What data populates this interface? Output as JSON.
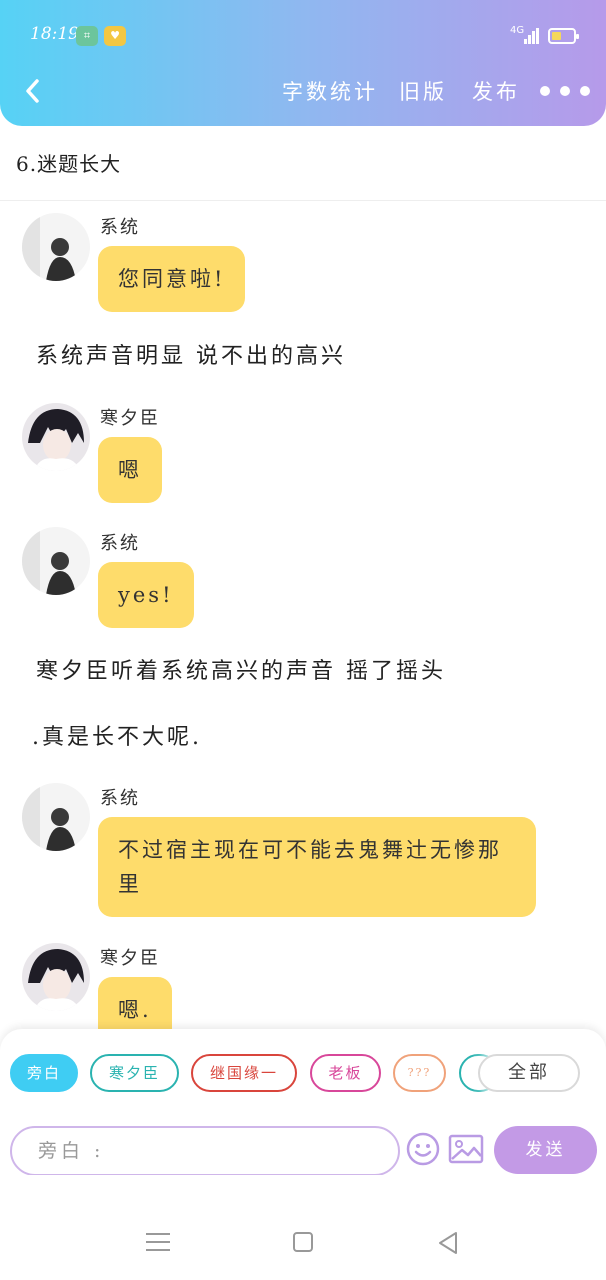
{
  "status_bar": {
    "time": "18:19",
    "network": "4G",
    "battery_level": 0.45
  },
  "header": {
    "actions": [
      "字数统计",
      "旧版",
      "发布"
    ],
    "gradient": [
      "#56d2f5",
      "#b69aea"
    ]
  },
  "chapter": {
    "title": "6.迷题长大"
  },
  "messages": [
    {
      "kind": "bubble",
      "speaker": "系统",
      "text": "您同意啦!",
      "avatar": "system"
    },
    {
      "kind": "narration",
      "text": "系统声音明显 说不出的高兴"
    },
    {
      "kind": "bubble",
      "speaker": "寒夕臣",
      "text": "嗯",
      "avatar": "hanxichen"
    },
    {
      "kind": "bubble",
      "speaker": "系统",
      "text": "yes!",
      "avatar": "system"
    },
    {
      "kind": "narration",
      "text": "寒夕臣听着系统高兴的声音 摇了摇头"
    },
    {
      "kind": "narration",
      "text": ".真是长不大呢."
    },
    {
      "kind": "bubble",
      "speaker": "系统",
      "text": "不过宿主现在可不能去鬼舞辻无惨那里",
      "avatar": "system"
    },
    {
      "kind": "bubble",
      "speaker": "寒夕臣",
      "text": "嗯.",
      "avatar": "hanxichen"
    }
  ],
  "role_chips": [
    {
      "label": "旁白",
      "color": "#3fcdf3",
      "active": true
    },
    {
      "label": "寒夕臣",
      "color": "#2ab3b0",
      "active": false
    },
    {
      "label": "继国缘一",
      "color": "#d9453c",
      "active": false
    },
    {
      "label": "老板",
      "color": "#d8479a",
      "active": false
    },
    {
      "label": "???",
      "color": "#f0a27a",
      "active": false
    },
    {
      "label": "",
      "color": "#2ab3b0",
      "active": false
    }
  ],
  "all_chip": "全部",
  "composer": {
    "placeholder": "旁白 :",
    "send_label": "发送"
  },
  "colors": {
    "bubble": "#fedc6b",
    "send": "#c39ae6",
    "input_border": "#cfb6ea"
  },
  "icons": {
    "back": "chevron-left-icon",
    "more": "more-dots-icon",
    "emoji": "smiley-icon",
    "image": "image-icon",
    "nav_menu": "menu-icon",
    "nav_home": "home-square-icon",
    "nav_back": "back-triangle-icon"
  }
}
